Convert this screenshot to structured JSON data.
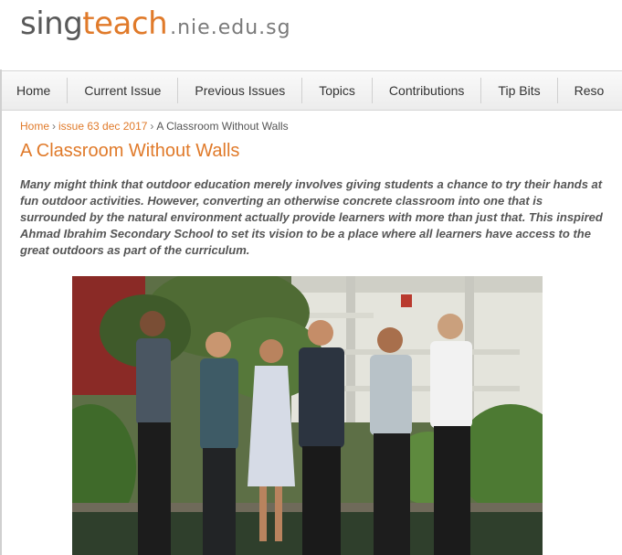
{
  "site": {
    "logo_sing": "sing",
    "logo_teach": "teach",
    "logo_domain": ".nie.edu.sg",
    "brand_color": "#e07a2a"
  },
  "nav": {
    "items": [
      "Home",
      "Current Issue",
      "Previous Issues",
      "Topics",
      "Contributions",
      "Tip Bits",
      "Reso"
    ]
  },
  "breadcrumb": {
    "home": "Home",
    "sep1": "›",
    "issue": "issue 63 dec 2017",
    "sep2": "›",
    "current": "A Classroom Without Walls"
  },
  "article": {
    "title": "A Classroom Without Walls",
    "lede": "Many might think that outdoor education merely involves giving students a chance to try their hands at fun outdoor activities. However, converting an otherwise concrete classroom into one that is surrounded by the natural environment actually provide learners with more than just that. This inspired Ahmad Ibrahim Secondary School to set its vision to be a place where all learners have access to the great outdoors as part of the curriculum."
  }
}
